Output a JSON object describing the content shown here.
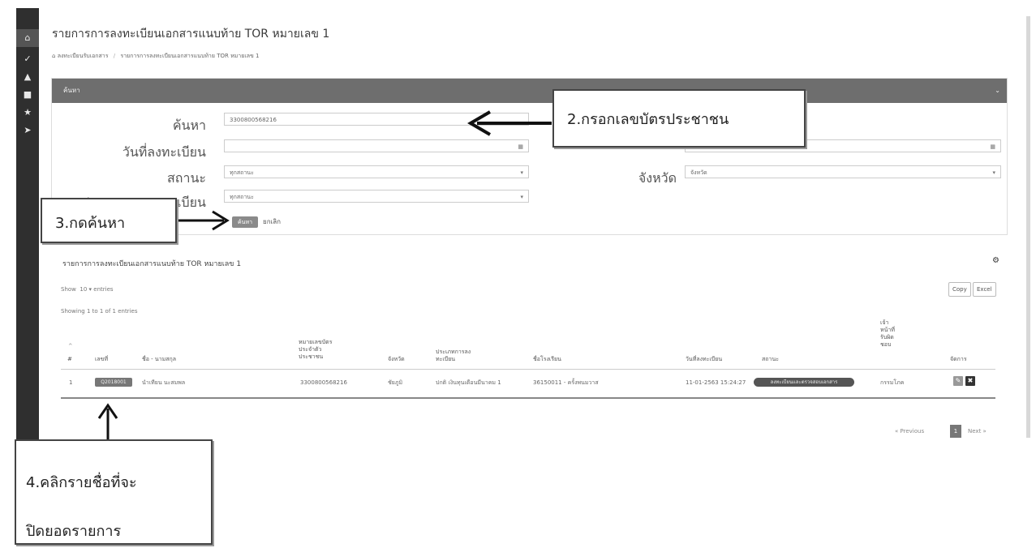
{
  "sidebar": {
    "icons": [
      "home-icon",
      "check-icon",
      "bank-icon",
      "briefcase-icon",
      "star-icon",
      "rocket-icon"
    ]
  },
  "page": {
    "title": "รายการการลงทะเบียนเอกสารแนบท้าย TOR หมายเลข 1",
    "breadcrumb": [
      "ลงทะเบียนรับเอกสาร",
      "รายการการลงทะเบียนเอกสารแนบท้าย TOR หมายเลข 1"
    ]
  },
  "search": {
    "header": "ค้นหา",
    "keyword_label": "ค้นหา",
    "keyword_value": "3300800568216",
    "regdate_label": "วันที่ลงทะเบียน",
    "status_label": "สถานะ",
    "status_value": "ทุกสถานะ",
    "province_label": "จังหวัด",
    "province_value": "จังหวัด",
    "regtype_label": "ประเภทการลงทะเบียน",
    "regtype_value": "ทุกสถานะ",
    "search_button": "ค้นหา",
    "cancel_button": "ยกเลิก"
  },
  "results": {
    "title": "รายการการลงทะเบียนเอกสารแนบท้าย TOR หมายเลข 1",
    "show_prefix": "Show",
    "show_value": "10",
    "show_suffix": "entries",
    "showing": "Showing 1 to 1 of 1 entries",
    "copy_button": "Copy",
    "excel_button": "Excel",
    "columns": {
      "no": "#",
      "code": "เลขที่",
      "name": "ชื่อ - นามสกุล",
      "idcard": "หมายเลขบัตรประจำตัวประชาชน",
      "province": "จังหวัด",
      "regtype": "ประเภทการลงทะเบียน",
      "school": "ชื่อโรงเรียน",
      "regdate": "วันที่ลงทะเบียน",
      "status": "สถานะ",
      "officer": "เจ้าหน้าที่รับผิดชอบ",
      "manage": "จัดการ"
    },
    "rows": [
      {
        "no": "1",
        "code": "Q2018001",
        "name": "นำเทียน นะสมพล",
        "idcard": "3300800568216",
        "province": "ชัยภูมิ",
        "regtype": "ปกติ เงินทุนเดือนมีนาคม 1",
        "school": "36150011 - ครั้งพนมวาส",
        "regdate": "11-01-2563 15:24:27",
        "status": "ลงทะเบียนและตรวจสอบเอกสาร",
        "officer": "กรรมโภค"
      }
    ],
    "pager": {
      "prev": "« Previous",
      "current": "1",
      "next": "Next »"
    }
  },
  "annotations": {
    "step2": "2.กรอกเลขบัตรประชาชน",
    "step3": "3.กดค้นหา",
    "step4_line1": "4.คลิกรายชื่อที่จะ",
    "step4_line2": "ปิดยอดรายการ"
  }
}
